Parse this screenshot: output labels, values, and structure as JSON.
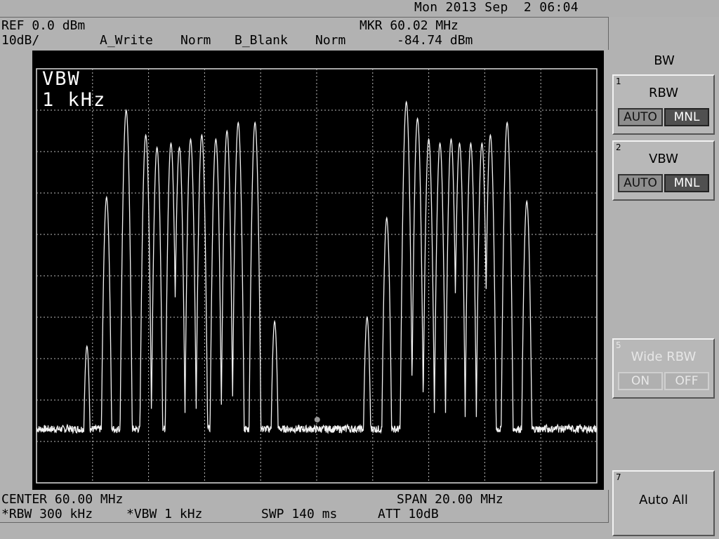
{
  "header": {
    "datetime": "Mon 2013 Sep  2 06:04",
    "ref_level": "REF 0.0 dBm",
    "scale": "10dB/",
    "trace_a": "A_Write",
    "trace_a_mode": "Norm",
    "trace_b": "B_Blank",
    "trace_b_mode": "Norm",
    "marker_freq": "MKR 60.02 MHz",
    "marker_amp": "-84.74 dBm"
  },
  "annotation": {
    "line1": "VBW",
    "line2": "1 kHz"
  },
  "footer": {
    "center": "CENTER 60.00 MHz",
    "span": "SPAN 20.00 MHz",
    "rbw": "*RBW 300 kHz",
    "vbw": "*VBW 1 kHz",
    "sweep": "SWP 140 ms",
    "atten": "ATT 10dB"
  },
  "menu": {
    "title": "BW",
    "keys": [
      {
        "num": "1",
        "label": "RBW",
        "opt_a": "AUTO",
        "opt_b": "MNL",
        "selected": "MNL"
      },
      {
        "num": "2",
        "label": "VBW",
        "opt_a": "AUTO",
        "opt_b": "MNL",
        "selected": "MNL"
      },
      {
        "num": "5",
        "label": "Wide RBW",
        "opt_a": "ON",
        "opt_b": "OFF",
        "selected": "OFF"
      },
      {
        "num": "7",
        "label": "Auto All"
      }
    ]
  },
  "chart_data": {
    "type": "line",
    "title": "",
    "xlabel": "",
    "ylabel": "",
    "x_unit": "MHz",
    "y_unit": "dBm",
    "xlim": [
      50,
      70
    ],
    "ylim": [
      -100,
      0
    ],
    "grid": true,
    "noise_floor": -87,
    "series": [
      {
        "peaks": [
          {
            "x": 51.1,
            "y": -86
          },
          {
            "x": 51.8,
            "y": -67
          },
          {
            "x": 52.5,
            "y": -31
          },
          {
            "x": 53.2,
            "y": -10
          },
          {
            "x": 53.9,
            "y": -16
          },
          {
            "x": 54.3,
            "y": -19
          },
          {
            "x": 54.8,
            "y": -18
          },
          {
            "x": 55.1,
            "y": -19
          },
          {
            "x": 55.5,
            "y": -17
          },
          {
            "x": 55.9,
            "y": -16
          },
          {
            "x": 56.4,
            "y": -17
          },
          {
            "x": 56.8,
            "y": -15
          },
          {
            "x": 57.2,
            "y": -13
          },
          {
            "x": 57.8,
            "y": -13
          },
          {
            "x": 58.5,
            "y": -61
          },
          {
            "x": 61.1,
            "y": -86
          },
          {
            "x": 61.8,
            "y": -60
          },
          {
            "x": 62.5,
            "y": -36
          },
          {
            "x": 63.2,
            "y": -8
          },
          {
            "x": 63.6,
            "y": -12
          },
          {
            "x": 64.0,
            "y": -17
          },
          {
            "x": 64.4,
            "y": -18
          },
          {
            "x": 64.8,
            "y": -17
          },
          {
            "x": 65.1,
            "y": -18
          },
          {
            "x": 65.5,
            "y": -18
          },
          {
            "x": 65.9,
            "y": -18
          },
          {
            "x": 66.2,
            "y": -16
          },
          {
            "x": 66.8,
            "y": -13
          },
          {
            "x": 67.5,
            "y": -32
          },
          {
            "x": 68.2,
            "y": -86
          },
          {
            "x": 68.6,
            "y": -86
          },
          {
            "x": 69.0,
            "y": -86
          },
          {
            "x": 69.4,
            "y": -86
          }
        ]
      }
    ],
    "marker": {
      "x": 60.02,
      "y": -84.74
    }
  }
}
